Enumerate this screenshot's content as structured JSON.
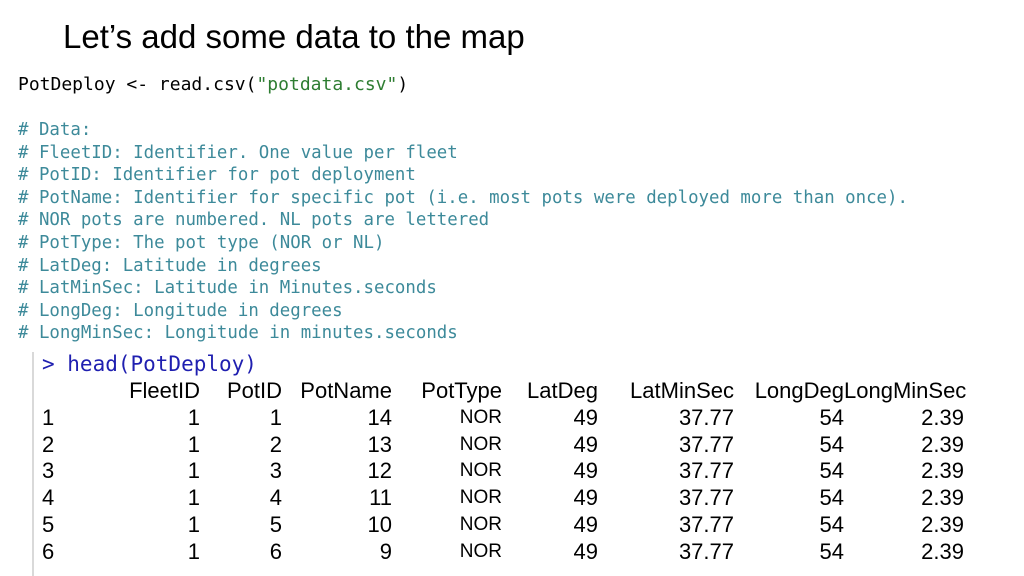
{
  "slide": {
    "title": "Let’s add some data to the map"
  },
  "code": {
    "variable": "PotDeploy",
    "operator": "<-",
    "function": "read.csv(",
    "argument": "\"potdata.csv\"",
    "close": ")"
  },
  "comments": [
    "# Data:",
    "# FleetID: Identifier. One value per fleet",
    "# PotID: Identifier for pot deployment",
    "# PotName: Identifier for specific pot (i.e. most pots were deployed more than once).",
    "# NOR pots are numbered. NL pots are lettered",
    "# PotType: The pot type (NOR or NL)",
    "# LatDeg: Latitude in degrees",
    "# LatMinSec: Latitude in Minutes.seconds",
    "# LongDeg: Longitude in degrees",
    "# LongMinSec: Longitude in minutes.seconds"
  ],
  "console": {
    "prompt": "> head(PotDeploy)",
    "headers": [
      "",
      "FleetID",
      "PotID",
      "PotName",
      "PotType",
      "LatDeg",
      "LatMinSec",
      "LongDeg",
      "LongMinSec"
    ],
    "rows": [
      [
        "1",
        "1",
        "1",
        "14",
        "NOR",
        "49",
        "37.77",
        "54",
        "2.39"
      ],
      [
        "2",
        "1",
        "2",
        "13",
        "NOR",
        "49",
        "37.77",
        "54",
        "2.39"
      ],
      [
        "3",
        "1",
        "3",
        "12",
        "NOR",
        "49",
        "37.77",
        "54",
        "2.39"
      ],
      [
        "4",
        "1",
        "4",
        "11",
        "NOR",
        "49",
        "37.77",
        "54",
        "2.39"
      ],
      [
        "5",
        "1",
        "5",
        "10",
        "NOR",
        "49",
        "37.77",
        "54",
        "2.39"
      ],
      [
        "6",
        "1",
        "6",
        "9",
        "NOR",
        "49",
        "37.77",
        "54",
        "2.39"
      ]
    ]
  },
  "colors": {
    "comment": "#3d8a9a",
    "string": "#2e7d32",
    "prompt": "#1f1fb0"
  }
}
